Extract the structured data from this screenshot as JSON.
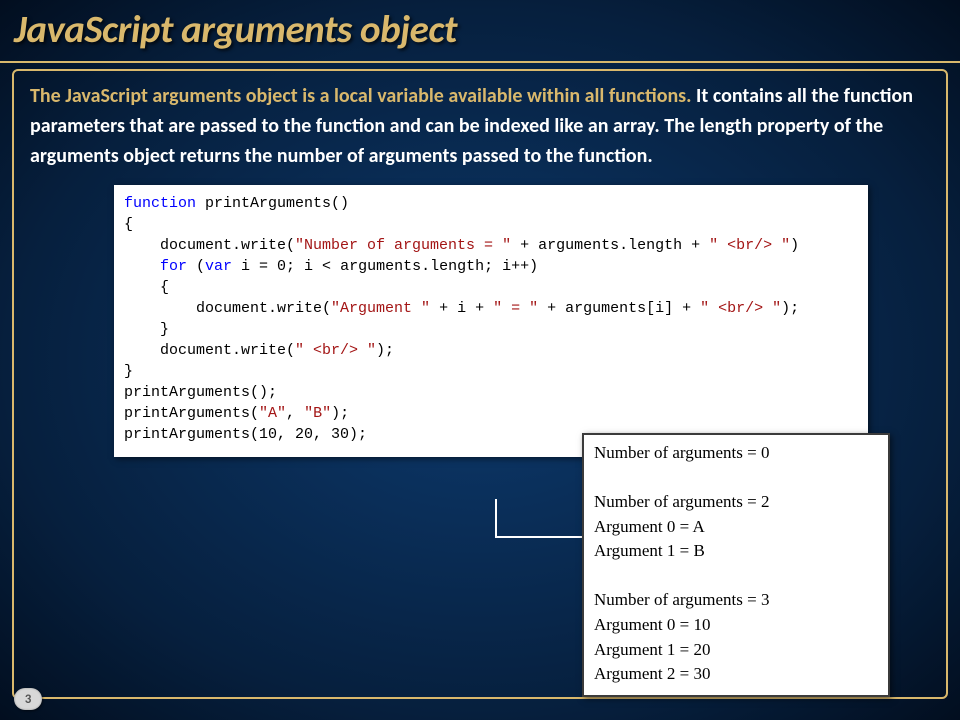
{
  "title": "JavaScript arguments object",
  "description": {
    "highlight": "The JavaScript arguments object is a local variable available within all functions.",
    "rest": " It contains all the function parameters that are passed to the function and can be indexed like an array. The length property of the arguments object returns the number of arguments passed to the function."
  },
  "code": {
    "l1a": "function",
    "l1b": " printArguments()",
    "l2": "{",
    "l3a": "    document.write(",
    "l3b": "\"Number of arguments = \"",
    "l3c": " + arguments.length + ",
    "l3d": "\" <br/> \"",
    "l3e": ")",
    "l4a": "    for",
    "l4b": " (",
    "l4c": "var",
    "l4d": " i = 0; i < arguments.length; i++)",
    "l5": "    {",
    "l6a": "        document.write(",
    "l6b": "\"Argument \"",
    "l6c": " + i + ",
    "l6d": "\" = \"",
    "l6e": " + arguments[i] + ",
    "l6f": "\" <br/> \"",
    "l6g": ");",
    "l7": "    }",
    "l8a": "    document.write(",
    "l8b": "\" <br/> \"",
    "l8c": ");",
    "l9": "}",
    "l10": "",
    "l11": "printArguments();",
    "l12a": "printArguments(",
    "l12b": "\"A\"",
    "l12c": ", ",
    "l12d": "\"B\"",
    "l12e": ");",
    "l13": "printArguments(10, 20, 30);"
  },
  "output": {
    "o1": "Number of arguments = 0",
    "o2": "",
    "o3": "Number of arguments = 2",
    "o4": "Argument 0 = A",
    "o5": "Argument 1 = B",
    "o6": "",
    "o7": "Number of arguments = 3",
    "o8": "Argument 0 = 10",
    "o9": "Argument 1 = 20",
    "o10": "Argument 2 = 30"
  },
  "slide_number": "3"
}
